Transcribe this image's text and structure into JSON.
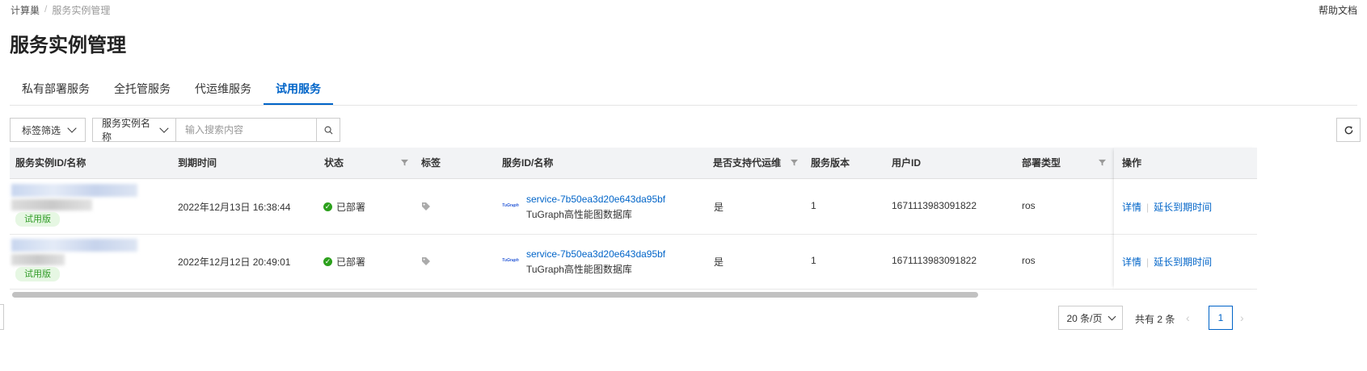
{
  "breadcrumb": {
    "root": "计算巢",
    "separator": "/",
    "current": "服务实例管理"
  },
  "help_link": "帮助文档",
  "title": "服务实例管理",
  "tabs": [
    "私有部署服务",
    "全托管服务",
    "代运维服务",
    "试用服务"
  ],
  "active_tab": 3,
  "toolbar": {
    "tag_filter_label": "标签筛选",
    "search_field_label": "服务实例名称",
    "search_placeholder": "输入搜索内容"
  },
  "table": {
    "columns": [
      "服务实例ID/名称",
      "到期时间",
      "状态",
      "标签",
      "服务ID/名称",
      "是否支持代运维",
      "服务版本",
      "用户ID",
      "部署类型",
      "操作"
    ],
    "rows": [
      {
        "badge": "试用版",
        "expire_time": "2022年12月13日 16:38:44",
        "status": "已部署",
        "service_logo": "TuGraph",
        "service_id": "service-7b50ea3d20e643da95bf",
        "service_name": "TuGraph高性能图数据库",
        "managed_support": "是",
        "version": "1",
        "user_id": "1671113983091822",
        "deploy_type": "ros",
        "action_detail": "详情",
        "action_extend": "延长到期时间"
      },
      {
        "badge": "试用版",
        "expire_time": "2022年12月12日 20:49:01",
        "status": "已部署",
        "service_logo": "TuGraph",
        "service_id": "service-7b50ea3d20e643da95bf",
        "service_name": "TuGraph高性能图数据库",
        "managed_support": "是",
        "version": "1",
        "user_id": "1671113983091822",
        "deploy_type": "ros",
        "action_detail": "详情",
        "action_extend": "延长到期时间"
      }
    ]
  },
  "pagination": {
    "page_size": "20 条/页",
    "total": "共有 2 条",
    "current_page": "1"
  },
  "colors": {
    "primary": "#0064c8",
    "success": "#2ca01c",
    "badge_bg": "#e6f7e3"
  }
}
